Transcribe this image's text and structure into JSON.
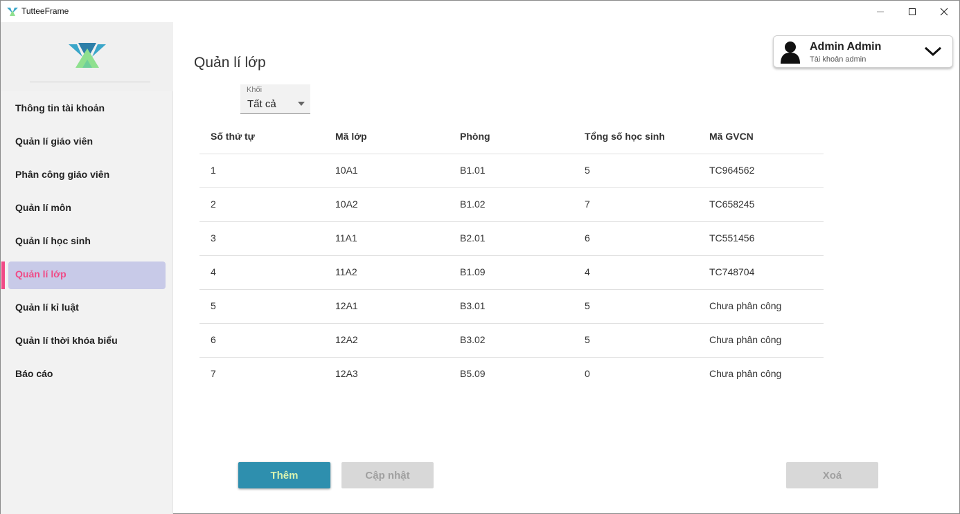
{
  "window": {
    "title": "TutteeFrame",
    "colors": {
      "accent": "#f04a86",
      "primary_button": "#2e8fae",
      "active_bg": "#c8cae8"
    }
  },
  "sidebar": {
    "items": [
      {
        "label": "Thông tin tài khoản"
      },
      {
        "label": "Quản lí giáo viên"
      },
      {
        "label": "Phân công giáo viên"
      },
      {
        "label": "Quản lí môn"
      },
      {
        "label": "Quản lí học sinh"
      },
      {
        "label": "Quản lí lớp",
        "active": true
      },
      {
        "label": "Quản lí kỉ luật"
      },
      {
        "label": "Quản lí thời khóa biểu"
      },
      {
        "label": "Báo cáo"
      }
    ]
  },
  "header": {
    "title": "Quản lí lớp",
    "user": {
      "name": "Admin Admin",
      "role": "Tài khoản admin"
    }
  },
  "filter": {
    "label": "Khối",
    "value": "Tất cả"
  },
  "table": {
    "headers": [
      "Số thứ tự",
      "Mã lớp",
      "Phòng",
      "Tổng số học sinh",
      "Mã GVCN"
    ],
    "rows": [
      [
        "1",
        "10A1",
        "B1.01",
        "5",
        "TC964562"
      ],
      [
        "2",
        "10A2",
        "B1.02",
        "7",
        "TC658245"
      ],
      [
        "3",
        "11A1",
        "B2.01",
        "6",
        "TC551456"
      ],
      [
        "4",
        "11A2",
        "B1.09",
        "4",
        "TC748704"
      ],
      [
        "5",
        "12A1",
        "B3.01",
        "5",
        "Chưa phân công"
      ],
      [
        "6",
        "12A2",
        "B3.02",
        "5",
        "Chưa phân công"
      ],
      [
        "7",
        "12A3",
        "B5.09",
        "0",
        "Chưa phân công"
      ]
    ]
  },
  "actions": {
    "add_label": "Thêm",
    "update_label": "Cập nhật",
    "delete_label": "Xoá"
  }
}
